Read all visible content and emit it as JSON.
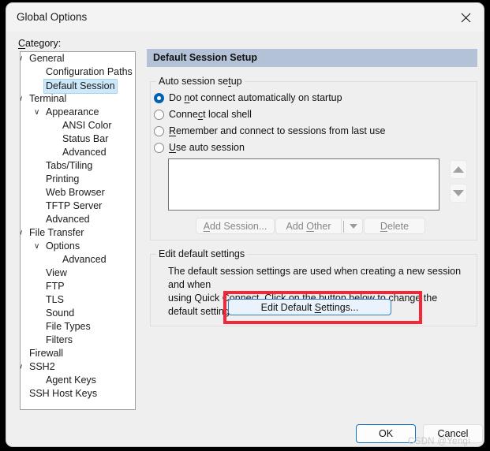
{
  "window": {
    "title": "Global Options",
    "close_icon": "close-icon"
  },
  "sidebar": {
    "label": "Category:",
    "label_mnemonic": "C",
    "items": [
      {
        "text": "General",
        "indent": 0,
        "chevron": true,
        "selected": false
      },
      {
        "text": "Configuration Paths",
        "indent": 1,
        "chevron": false,
        "selected": false
      },
      {
        "text": "Default Session",
        "indent": 1,
        "chevron": false,
        "selected": true
      },
      {
        "text": "Terminal",
        "indent": 0,
        "chevron": true,
        "selected": false
      },
      {
        "text": "Appearance",
        "indent": 1,
        "chevron": true,
        "selected": false
      },
      {
        "text": "ANSI Color",
        "indent": 2,
        "chevron": false,
        "selected": false
      },
      {
        "text": "Status Bar",
        "indent": 2,
        "chevron": false,
        "selected": false
      },
      {
        "text": "Advanced",
        "indent": 2,
        "chevron": false,
        "selected": false
      },
      {
        "text": "Tabs/Tiling",
        "indent": 1,
        "chevron": false,
        "selected": false
      },
      {
        "text": "Printing",
        "indent": 1,
        "chevron": false,
        "selected": false
      },
      {
        "text": "Web Browser",
        "indent": 1,
        "chevron": false,
        "selected": false
      },
      {
        "text": "TFTP Server",
        "indent": 1,
        "chevron": false,
        "selected": false
      },
      {
        "text": "Advanced",
        "indent": 1,
        "chevron": false,
        "selected": false
      },
      {
        "text": "File Transfer",
        "indent": 0,
        "chevron": true,
        "selected": false
      },
      {
        "text": "Options",
        "indent": 1,
        "chevron": true,
        "selected": false
      },
      {
        "text": "Advanced",
        "indent": 2,
        "chevron": false,
        "selected": false
      },
      {
        "text": "View",
        "indent": 1,
        "chevron": false,
        "selected": false
      },
      {
        "text": "FTP",
        "indent": 1,
        "chevron": false,
        "selected": false
      },
      {
        "text": "TLS",
        "indent": 1,
        "chevron": false,
        "selected": false
      },
      {
        "text": "Sound",
        "indent": 1,
        "chevron": false,
        "selected": false
      },
      {
        "text": "File Types",
        "indent": 1,
        "chevron": false,
        "selected": false
      },
      {
        "text": "Filters",
        "indent": 1,
        "chevron": false,
        "selected": false
      },
      {
        "text": "Firewall",
        "indent": 0,
        "chevron": false,
        "selected": false
      },
      {
        "text": "SSH2",
        "indent": 0,
        "chevron": true,
        "selected": false
      },
      {
        "text": "Agent Keys",
        "indent": 1,
        "chevron": false,
        "selected": false
      },
      {
        "text": "SSH Host Keys",
        "indent": 0,
        "chevron": false,
        "selected": false
      }
    ]
  },
  "main": {
    "header_title": "Default Session Setup",
    "header_color": "#b3c2d6",
    "auto_session": {
      "group_title": "Auto session setup",
      "group_title_mnemonic": "t",
      "options": [
        {
          "label": "Do not connect automatically on startup",
          "mnemonic": "n",
          "selected": true
        },
        {
          "label": "Connect local shell",
          "mnemonic": "c",
          "selected": false
        },
        {
          "label": "Remember and connect to sessions from last use",
          "mnemonic": "R",
          "selected": false
        },
        {
          "label": "Use auto session",
          "mnemonic": "U",
          "selected": false
        }
      ],
      "session_list_items": [],
      "spin_up_icon": "arrow-up-icon",
      "spin_down_icon": "arrow-down-icon",
      "buttons": [
        {
          "label": "Add Session...",
          "mnemonic": "A",
          "disabled": true
        },
        {
          "label": "Add Other",
          "mnemonic": "O",
          "disabled": true
        },
        {
          "label": "Delete",
          "mnemonic": "D",
          "disabled": true
        }
      ],
      "dropdown_icon": "chevron-down-icon"
    },
    "edit_defaults": {
      "group_title": "Edit default settings",
      "description_line1": "The default session settings are used when creating a new session and when",
      "description_line2": "using Quick Connect.  Click on the button below to change the default settings.",
      "button_label": "Edit Default Settings...",
      "button_mnemonic": "S",
      "highlight_color": "#f32735"
    }
  },
  "footer": {
    "ok_label": "OK",
    "cancel_label": "Cancel"
  },
  "watermark": {
    "text": "CSDN @Yengi"
  }
}
